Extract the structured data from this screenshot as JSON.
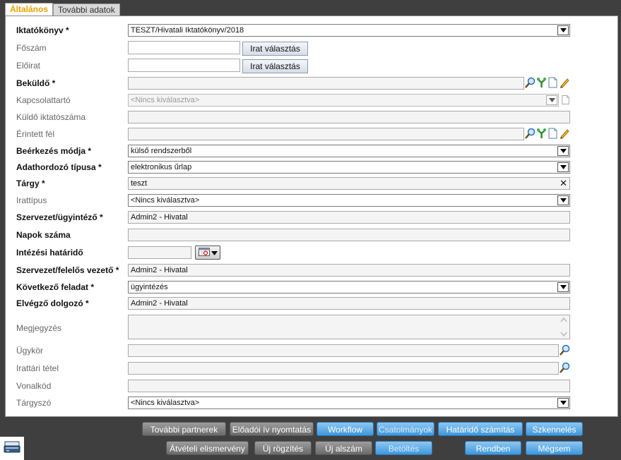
{
  "tabs": [
    {
      "label": "Általános",
      "active": true
    },
    {
      "label": "További adatok",
      "active": false
    }
  ],
  "fields": {
    "iktatokonyv": {
      "label": "Iktatókönyv *",
      "value": "TESZT/Hivatali Iktatókönyv/2018"
    },
    "foszam": {
      "label": "Főszám",
      "value": "",
      "button": "Irat választás"
    },
    "eloirat": {
      "label": "Előirat",
      "value": "",
      "button": "Irat választás"
    },
    "bekuldo": {
      "label": "Beküldő *",
      "value": ""
    },
    "kapcsolattarto": {
      "label": "Kapcsolattartó",
      "value": "<Nincs kiválasztva>"
    },
    "kuldo_iktatoszama": {
      "label": "Küldő iktatószáma",
      "value": ""
    },
    "erintett_fel": {
      "label": "Érintett fél",
      "value": ""
    },
    "beerkezes_modja": {
      "label": "Beérkezés módja *",
      "value": "külső rendszerből"
    },
    "adathordozo_tipusa": {
      "label": "Adathordozó típusa *",
      "value": "elektronikus űrlap"
    },
    "targy": {
      "label": "Tárgy *",
      "value": "teszt",
      "clear": "✕"
    },
    "irattipus": {
      "label": "Irattípus",
      "value": "<Nincs kiválasztva>"
    },
    "szervezet_ugyintezo": {
      "label": "Szervezet/ügyintéző *",
      "value": "Admin2 - Hivatal"
    },
    "napok_szama": {
      "label": "Napok száma",
      "value": ""
    },
    "intezesi_hatarido": {
      "label": "Intézési határidő",
      "value": ""
    },
    "szervezet_felelos_vezeto": {
      "label": "Szervezet/felelős vezető *",
      "value": "Admin2 - Hivatal"
    },
    "kovetkezo_feladat": {
      "label": "Következő feladat *",
      "value": "ügyintézés"
    },
    "elvegzo_dolgozo": {
      "label": "Elvégző dolgozó *",
      "value": "Admin2 - Hivatal"
    },
    "megjegyzes": {
      "label": "Megjegyzés",
      "value": ""
    },
    "ugykor": {
      "label": "Ügykör",
      "value": ""
    },
    "irattari_tetel": {
      "label": "Irattári tétel",
      "value": ""
    },
    "vonalkod": {
      "label": "Vonalkód",
      "value": ""
    },
    "targyszo": {
      "label": "Tárgyszó",
      "value": "<Nincs kiválasztva>"
    }
  },
  "buttons_row1": [
    "További partnerek",
    "Előadói ív nyomtatás",
    "Workflow",
    "Csatolmányok",
    "Határidő számítás",
    "Szkennelés"
  ],
  "buttons_row2": [
    "Átvételi elismervény",
    "Új rögzítés",
    "Új alszám",
    "Betöltés",
    "Rendben",
    "Mégsem"
  ],
  "icons": [
    "search-icon",
    "tree-icon",
    "new-document-icon",
    "edit-pencil-icon",
    "calendar-icon",
    "scanner-icon"
  ],
  "colors": {
    "active_tab": "#e6a100",
    "blue_button": "#3e97da",
    "grey_button": "#6a6a6a",
    "background": "#3f3f3f"
  }
}
